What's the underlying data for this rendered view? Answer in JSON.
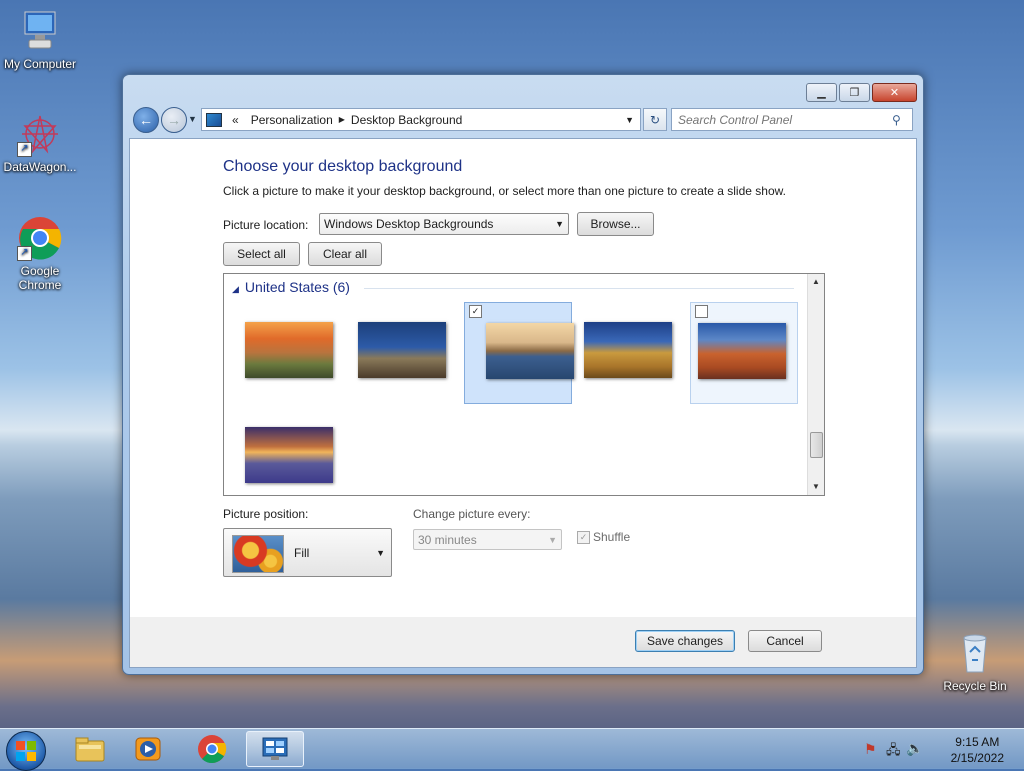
{
  "desktop": {
    "icons": [
      {
        "label": "My Computer"
      },
      {
        "label": "DataWagon..."
      },
      {
        "label": "Google Chrome"
      },
      {
        "label": "Recycle Bin"
      }
    ]
  },
  "window": {
    "controls": {
      "minimize": "▁",
      "maximize": "❐",
      "close": "✕"
    },
    "address": {
      "breadcrumbs": [
        "«",
        "Personalization",
        "Desktop Background"
      ]
    },
    "search": {
      "placeholder": "Search Control Panel"
    }
  },
  "page": {
    "heading": "Choose your desktop background",
    "description": "Click a picture to make it your desktop background, or select more than one picture to create a slide show.",
    "picture_location_label": "Picture location:",
    "picture_location_value": "Windows Desktop Backgrounds",
    "browse_label": "Browse...",
    "select_all_label": "Select all",
    "clear_all_label": "Clear all",
    "group_title": "United States (6)",
    "thumbnails": [
      {
        "name": "sunset-field",
        "selected": false
      },
      {
        "name": "lighthouse",
        "selected": false
      },
      {
        "name": "rock-reflection",
        "selected": true
      },
      {
        "name": "hay-bale",
        "selected": false
      },
      {
        "name": "arch-rock",
        "selected": false
      },
      {
        "name": "lupine-sunset",
        "selected": false
      }
    ],
    "picture_position_label": "Picture position:",
    "picture_position_value": "Fill",
    "change_picture_label": "Change picture every:",
    "change_picture_value": "30 minutes",
    "shuffle_label": "Shuffle",
    "save_label": "Save changes",
    "cancel_label": "Cancel"
  },
  "taskbar": {
    "items": [
      "start",
      "explorer",
      "media-player",
      "chrome",
      "control-panel"
    ],
    "clock_time": "9:15 AM",
    "clock_date": "2/15/2022"
  }
}
